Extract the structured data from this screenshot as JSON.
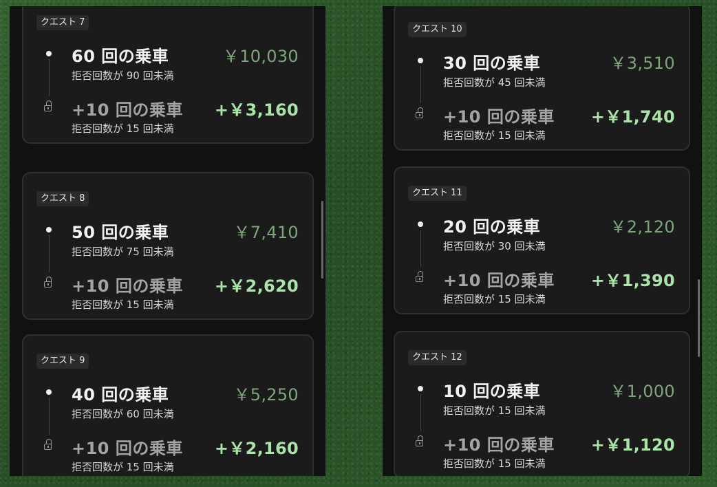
{
  "left_panel": {
    "cards": [
      {
        "badge": "クエスト 7",
        "goal": "60 回の乗車",
        "goal_condition": "拒否回数が 90 回未満",
        "goal_reward": "￥10,030",
        "bonus": "+10 回の乗車",
        "bonus_condition": "拒否回数が 15 回未満",
        "bonus_reward": "+￥3,160"
      },
      {
        "badge": "クエスト 8",
        "goal": "50 回の乗車",
        "goal_condition": "拒否回数が 75 回未満",
        "goal_reward": "￥7,410",
        "bonus": "+10 回の乗車",
        "bonus_condition": "拒否回数が 15 回未満",
        "bonus_reward": "+￥2,620"
      },
      {
        "badge": "クエスト 9",
        "goal": "40 回の乗車",
        "goal_condition": "拒否回数が 60 回未満",
        "goal_reward": "￥5,250",
        "bonus": "+10 回の乗車",
        "bonus_condition": "拒否回数が 15 回未満",
        "bonus_reward": "+￥2,160"
      }
    ]
  },
  "right_panel": {
    "cards": [
      {
        "badge": "クエスト 10",
        "goal": "30 回の乗車",
        "goal_condition": "拒否回数が 45 回未満",
        "goal_reward": "￥3,510",
        "bonus": "+10 回の乗車",
        "bonus_condition": "拒否回数が 15 回未満",
        "bonus_reward": "+￥1,740"
      },
      {
        "badge": "クエスト 11",
        "goal": "20 回の乗車",
        "goal_condition": "拒否回数が 30 回未満",
        "goal_reward": "￥2,120",
        "bonus": "+10 回の乗車",
        "bonus_condition": "拒否回数が 15 回未満",
        "bonus_reward": "+￥1,390"
      },
      {
        "badge": "クエスト 12",
        "goal": "10 回の乗車",
        "goal_condition": "拒否回数が 15 回未満",
        "goal_reward": "￥1,000",
        "bonus": "+10 回の乗車",
        "bonus_condition": "拒否回数が 15 回未満",
        "bonus_reward": "+￥1,120"
      }
    ]
  },
  "icons": {
    "milestone": "dot-icon",
    "locked": "lock-icon"
  },
  "colors": {
    "background": "#2f5a2c",
    "card": "#1b1b1b",
    "reward": "#7ea57b",
    "bonus_reward": "#a9e5a7"
  }
}
